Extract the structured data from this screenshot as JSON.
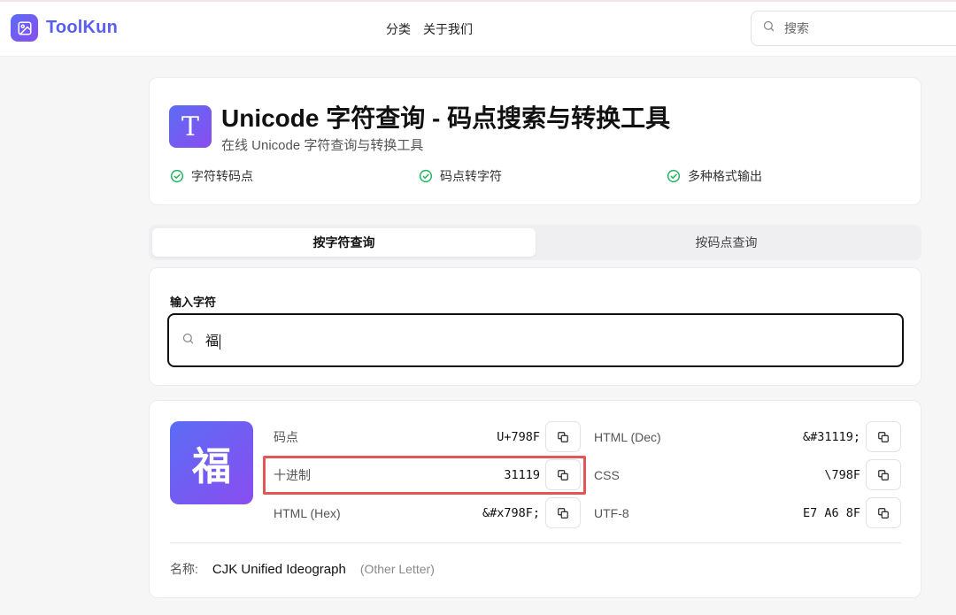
{
  "header": {
    "brand": "ToolKun",
    "nav": [
      "分类",
      "关于我们"
    ],
    "search_placeholder": "搜索"
  },
  "hero": {
    "icon_glyph": "T",
    "title": "Unicode 字符查询 - 码点搜索与转换工具",
    "subtitle": "在线 Unicode 字符查询与转换工具",
    "features": [
      "字符转码点",
      "码点转字符",
      "多种格式输出"
    ]
  },
  "tabs": [
    {
      "label": "按字符查询",
      "active": true
    },
    {
      "label": "按码点查询",
      "active": false
    }
  ],
  "input": {
    "label": "输入字符",
    "value": "福"
  },
  "result": {
    "char": "福",
    "left": [
      {
        "label": "码点",
        "value": "U+798F"
      },
      {
        "label": "十进制",
        "value": "31119"
      },
      {
        "label": "HTML (Hex)",
        "value": "&#x798F;"
      }
    ],
    "right": [
      {
        "label": "HTML (Dec)",
        "value": "&#31119;"
      },
      {
        "label": "CSS",
        "value": "\\798F"
      },
      {
        "label": "UTF-8",
        "value": "E7 A6 8F"
      }
    ],
    "name_label": "名称:",
    "name": "CJK Unified Ideograph",
    "category": "(Other Letter)"
  },
  "colors": {
    "brand": "#5a5ef0",
    "accent_gradient_start": "#5b6cf5",
    "accent_gradient_end": "#8a4df0",
    "check_green": "#22b35e",
    "highlight_red": "#e25656"
  }
}
